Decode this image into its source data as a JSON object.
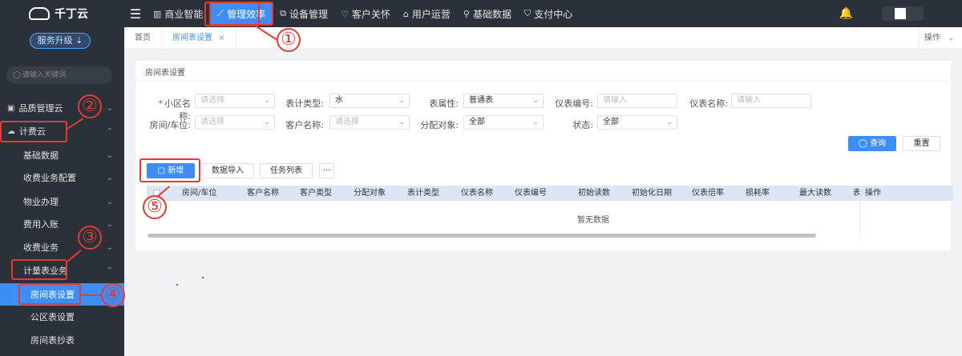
{
  "brand": {
    "name": "千丁云"
  },
  "topnav": {
    "items": [
      {
        "label": "商业智能",
        "icon": "bar-chart-icon"
      },
      {
        "label": "管理效率",
        "icon": "line-chart-icon"
      },
      {
        "label": "设备管理",
        "icon": "device-icon"
      },
      {
        "label": "客户关怀",
        "icon": "heart-icon"
      },
      {
        "label": "用户运营",
        "icon": "users-icon"
      },
      {
        "label": "基础数据",
        "icon": "wrench-icon"
      },
      {
        "label": "支付中心",
        "icon": "shield-icon"
      }
    ],
    "active": "管理效率"
  },
  "sidebar": {
    "upgrade_label": "服务升级",
    "search_placeholder": "请输入关键词",
    "items": [
      {
        "label": "品质管理云",
        "icon": "quality-icon"
      },
      {
        "label": "计费云",
        "icon": "cloud-icon"
      },
      {
        "label": "基础数据"
      },
      {
        "label": "收费业务配置"
      },
      {
        "label": "物业办理"
      },
      {
        "label": "费用入账"
      },
      {
        "label": "收费业务"
      },
      {
        "label": "计量表业务"
      },
      {
        "label": "房间表设置"
      },
      {
        "label": "公区表设置"
      },
      {
        "label": "房间表抄表"
      }
    ]
  },
  "tabs": {
    "items": [
      {
        "label": "首页"
      },
      {
        "label": "房间表设置",
        "close": "×"
      }
    ],
    "ops_label": "操作"
  },
  "panel": {
    "title": "房间表设置",
    "filters": {
      "community": {
        "label": "小区名称:",
        "placeholder": "请选择"
      },
      "meter_type": {
        "label": "表计类型:",
        "value": "水"
      },
      "meter_attr": {
        "label": "表属性:",
        "value": "普通表"
      },
      "meter_no": {
        "label": "仪表编号:",
        "placeholder": "请输入"
      },
      "meter_name": {
        "label": "仪表名称:",
        "placeholder": "请输入"
      },
      "room": {
        "label": "房间/车位:",
        "placeholder": "请选择"
      },
      "customer": {
        "label": "客户名称:",
        "placeholder": "请选择"
      },
      "alloc": {
        "label": "分配对象:",
        "value": "全部"
      },
      "status": {
        "label": "状态:",
        "value": "全部"
      }
    },
    "buttons": {
      "query": "查询",
      "reset": "重置",
      "add": "新增",
      "import": "数据导入",
      "tasks": "任务列表",
      "more": "···"
    },
    "table": {
      "columns": [
        "房间/车位",
        "客户名称",
        "客户类型",
        "分配对象",
        "表计类型",
        "仪表名称",
        "仪表编号",
        "初始读数",
        "初始化日期",
        "仪表倍率",
        "损耗率",
        "最大读数",
        "表"
      ],
      "ops_column": "操作",
      "empty_text": "暂无数据"
    }
  },
  "annotations": [
    "①",
    "②",
    "③",
    "④",
    "⑤"
  ],
  "colors": {
    "accent": "#3e8ef7",
    "annotation": "#e53935",
    "nav_bg": "#2b3138"
  }
}
